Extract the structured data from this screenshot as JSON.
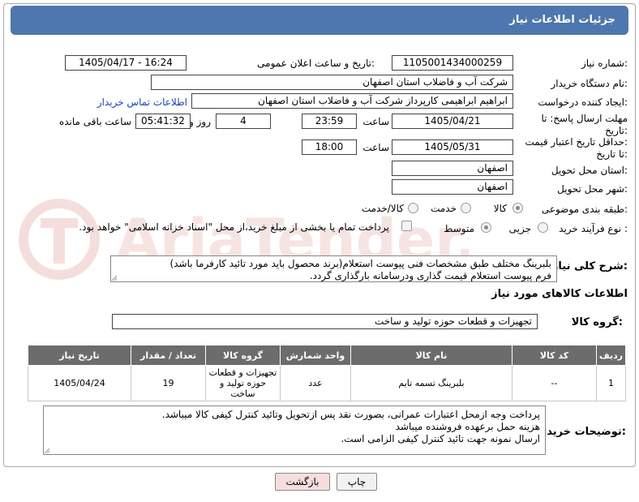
{
  "title": "جزئیات اطلاعات نیاز",
  "fields": {
    "need_number": {
      "label": "شماره نیاز:",
      "value": "1105001434000259"
    },
    "announce": {
      "label": "تاریخ و ساعت اعلان عمومی:",
      "value": "1405/04/17 - 16:24"
    },
    "buyer_org": {
      "label": "نام دستگاه خریدار:",
      "value": "شرکت آب و فاضلاب استان اصفهان"
    },
    "requester": {
      "label": "ایجاد کننده درخواست:",
      "value": "ابراهیم ابراهیمی کارپرداز شرکت آب و فاضلاب استان اصفهان",
      "contact_link": "اطلاعات تماس خریدار"
    },
    "reply_deadline": {
      "label1": "مهلت ارسال پاسخ: تا",
      "label2": "تاریخ:",
      "date": "1405/04/21",
      "time_label": "ساعت",
      "time": "23:59",
      "days": "4",
      "days_label": "روز و",
      "remaining": "05:41:32",
      "remaining_label": "ساعت باقی مانده"
    },
    "price_validity": {
      "label1": "حداقل تاریخ اعتبار قیمت:",
      "label2": "تا تاریخ:",
      "date": "1405/05/31",
      "time_label": "ساعت",
      "time": "18:00"
    },
    "province": {
      "label": "استان محل تحویل:",
      "value": "اصفهان"
    },
    "city": {
      "label": "شهر محل تحویل:",
      "value": "اصفهان"
    },
    "category": {
      "label": "طبقه بندی موضوعی:",
      "options": [
        "کالا",
        "خدمت",
        "کالا/خدمت"
      ],
      "selected": "کالا"
    },
    "process": {
      "label": "نوع فرآیند خرید :",
      "options": [
        "جزیی",
        "متوسط"
      ],
      "selected": "متوسط",
      "note": "پرداخت تمام یا بخشی از مبلغ خرید،از محل \"اسناد خزانه اسلامی\" خواهد بود."
    }
  },
  "description": {
    "label": "شرح کلی نیاز:",
    "lines": [
      "بلبرینگ مختلف طبق مشخصات فنی پیوست استعلام(برند محصول باید مورد تائید کارفرما باشد)",
      "فرم پیوست استعلام قیمت گذاری ودرسامانه بارگذاری گردد."
    ]
  },
  "goods_info": {
    "heading": "اطلاعات کالاهای مورد نیاز",
    "group_label": "گروه کالا:",
    "group_value": "تجهیزات و قطعات حوزه تولید و ساخت"
  },
  "table": {
    "headers": [
      "ردیف",
      "کد کالا",
      "نام کالا",
      "واحد شمارش",
      "گروه کالا",
      "تعداد / مقدار",
      "تاریخ نیاز"
    ],
    "rows": [
      {
        "row": "1",
        "code": "--",
        "name": "بلبرینگ تسمه تایم",
        "unit": "عدد",
        "group": "تجهیزات و قطعات حوزه تولید و ساخت",
        "qty": "19",
        "date": "1405/04/24"
      }
    ]
  },
  "buyer_notes": {
    "label": "توضیحات خریدار:",
    "lines": [
      "پرداخت وجه ازمحل اعتبارات عمرانی، بصورت نقد پس ازتحویل وتائید کنترل کیفی کالا میباشد.",
      "هزینه حمل برعهده فروشنده میباشد",
      "ارسال نمونه جهت تائید کنترل کیفی الزامی است."
    ]
  },
  "buttons": {
    "print": "چاپ",
    "back": "بازگشت"
  },
  "watermark": "AriaTender.net",
  "colors": {
    "title_bg": "#4d77ae",
    "table_head": "#6c6c6c",
    "link": "#1a44c4",
    "back_btn": "#f7dede"
  }
}
